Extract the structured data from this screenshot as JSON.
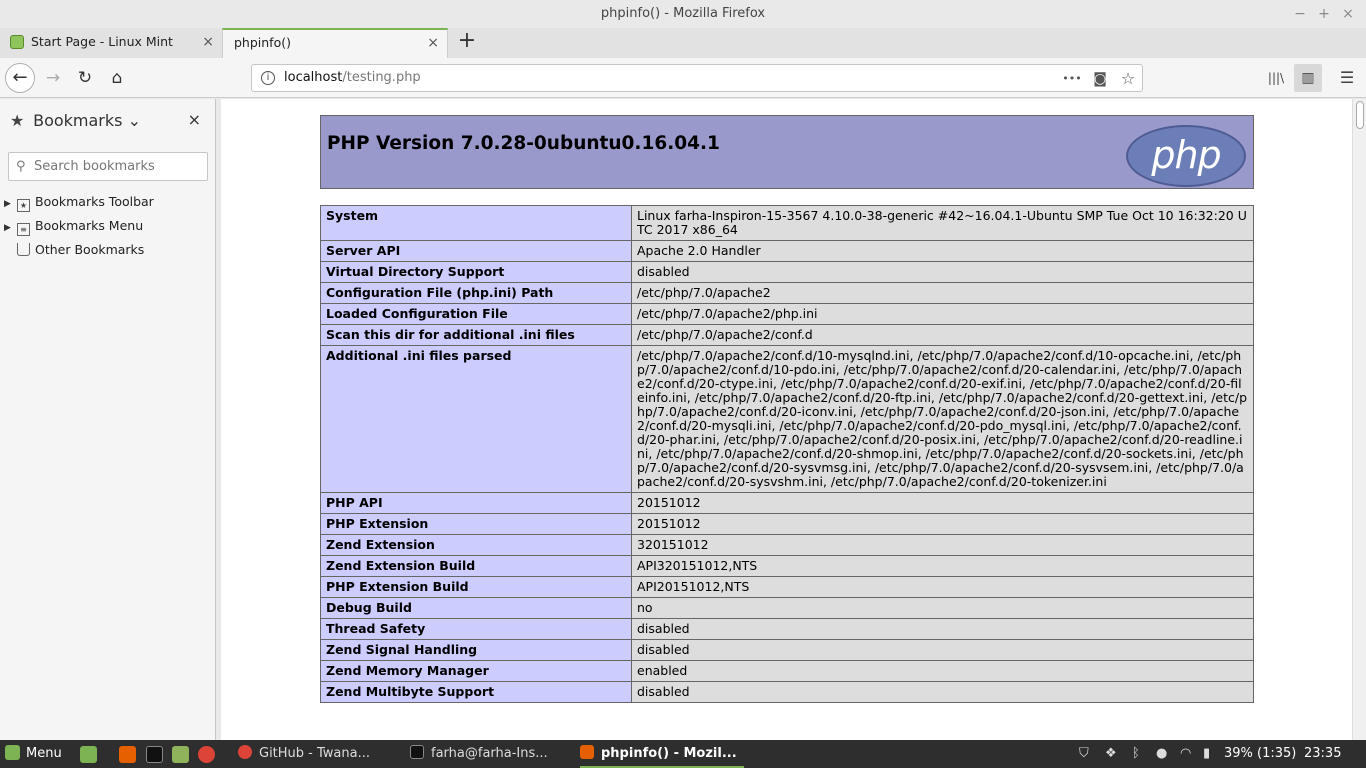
{
  "window": {
    "title": "phpinfo() - Mozilla Firefox",
    "minimize": "−",
    "maximize": "+",
    "close": "×"
  },
  "tabs": [
    {
      "label": "Start Page - Linux Mint",
      "close": "×",
      "active": false
    },
    {
      "label": "phpinfo()",
      "close": "×",
      "active": true
    }
  ],
  "new_tab": "+",
  "nav": {
    "back": "←",
    "forward": "→",
    "reload": "↻",
    "home": "⌂",
    "url_host": "localhost",
    "url_path": "/testing.php",
    "page_actions": "•••",
    "pocket": "◙",
    "bookmark_star": "☆",
    "library": "|||\\",
    "sidebar_toggle": "▥",
    "menu": "☰"
  },
  "sidebar": {
    "title": "Bookmarks",
    "dropdown": "⌄",
    "close": "×",
    "search_placeholder": "Search bookmarks",
    "items": [
      {
        "label": "Bookmarks Toolbar",
        "expander": "▶",
        "icon": "toolbar-icon"
      },
      {
        "label": "Bookmarks Menu",
        "expander": "▶",
        "icon": "menu-icon"
      },
      {
        "label": "Other Bookmarks",
        "expander": "",
        "icon": "folder-icon"
      }
    ]
  },
  "php": {
    "version_title": "PHP Version 7.0.28-0ubuntu0.16.04.1",
    "logo_text": "php",
    "rows": [
      {
        "key": "System",
        "value": "Linux farha-Inspiron-15-3567 4.10.0-38-generic #42~16.04.1-Ubuntu SMP Tue Oct 10 16:32:20 UTC 2017 x86_64"
      },
      {
        "key": "Server API",
        "value": "Apache 2.0 Handler"
      },
      {
        "key": "Virtual Directory Support",
        "value": "disabled"
      },
      {
        "key": "Configuration File (php.ini) Path",
        "value": "/etc/php/7.0/apache2"
      },
      {
        "key": "Loaded Configuration File",
        "value": "/etc/php/7.0/apache2/php.ini"
      },
      {
        "key": "Scan this dir for additional .ini files",
        "value": "/etc/php/7.0/apache2/conf.d"
      },
      {
        "key": "Additional .ini files parsed",
        "value": "/etc/php/7.0/apache2/conf.d/10-mysqlnd.ini, /etc/php/7.0/apache2/conf.d/10-opcache.ini, /etc/php/7.0/apache2/conf.d/10-pdo.ini, /etc/php/7.0/apache2/conf.d/20-calendar.ini, /etc/php/7.0/apache2/conf.d/20-ctype.ini, /etc/php/7.0/apache2/conf.d/20-exif.ini, /etc/php/7.0/apache2/conf.d/20-fileinfo.ini, /etc/php/7.0/apache2/conf.d/20-ftp.ini, /etc/php/7.0/apache2/conf.d/20-gettext.ini, /etc/php/7.0/apache2/conf.d/20-iconv.ini, /etc/php/7.0/apache2/conf.d/20-json.ini, /etc/php/7.0/apache2/conf.d/20-mysqli.ini, /etc/php/7.0/apache2/conf.d/20-pdo_mysql.ini, /etc/php/7.0/apache2/conf.d/20-phar.ini, /etc/php/7.0/apache2/conf.d/20-posix.ini, /etc/php/7.0/apache2/conf.d/20-readline.ini, /etc/php/7.0/apache2/conf.d/20-shmop.ini, /etc/php/7.0/apache2/conf.d/20-sockets.ini, /etc/php/7.0/apache2/conf.d/20-sysvmsg.ini, /etc/php/7.0/apache2/conf.d/20-sysvsem.ini, /etc/php/7.0/apache2/conf.d/20-sysvshm.ini, /etc/php/7.0/apache2/conf.d/20-tokenizer.ini"
      },
      {
        "key": "PHP API",
        "value": "20151012"
      },
      {
        "key": "PHP Extension",
        "value": "20151012"
      },
      {
        "key": "Zend Extension",
        "value": "320151012"
      },
      {
        "key": "Zend Extension Build",
        "value": "API320151012,NTS"
      },
      {
        "key": "PHP Extension Build",
        "value": "API20151012,NTS"
      },
      {
        "key": "Debug Build",
        "value": "no"
      },
      {
        "key": "Thread Safety",
        "value": "disabled"
      },
      {
        "key": "Zend Signal Handling",
        "value": "disabled"
      },
      {
        "key": "Zend Memory Manager",
        "value": "enabled"
      },
      {
        "key": "Zend Multibyte Support",
        "value": "disabled"
      }
    ]
  },
  "taskbar": {
    "menu_label": "Menu",
    "windows": [
      {
        "label": "GitHub - Twana...",
        "active": false
      },
      {
        "label": "farha@farha-Ins...",
        "active": false
      },
      {
        "label": "phpinfo() - Mozil...",
        "active": true
      }
    ],
    "battery": "39% (1:35)",
    "clock": "23:35"
  },
  "colors": {
    "php_header": "#9999cc",
    "php_key_cell": "#ccccff",
    "php_value_cell": "#dddddd",
    "mint_accent": "#7db352"
  }
}
